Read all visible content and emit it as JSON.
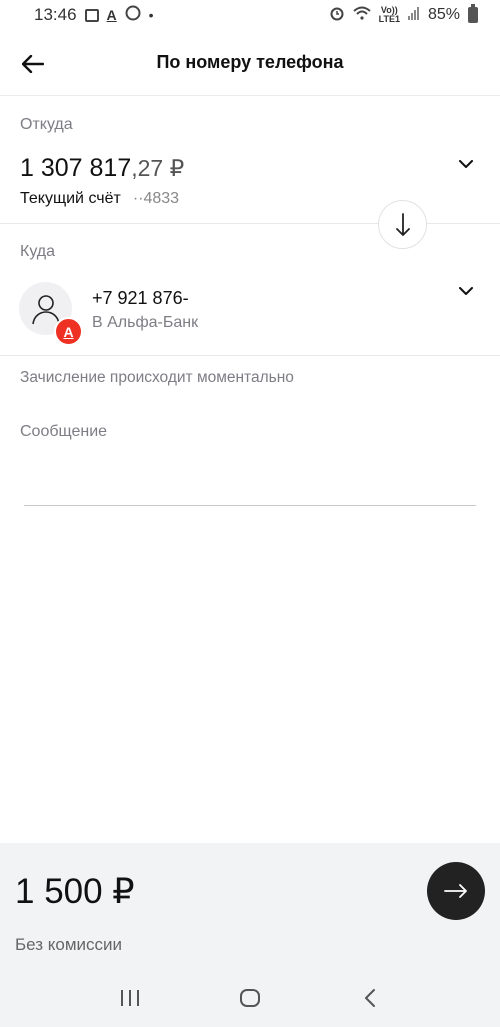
{
  "status_bar": {
    "time": "13:46",
    "a_glyph": "A",
    "dot": "•",
    "volte_top": "Vo))",
    "volte_bottom": "LTE1",
    "battery": "85%"
  },
  "header": {
    "title": "По номеру телефона"
  },
  "from": {
    "label": "Откуда",
    "balance_main": "1 307 817",
    "balance_cents": ",27 ₽",
    "account_name": "Текущий счёт",
    "account_number": "··4833"
  },
  "to": {
    "label": "Куда",
    "phone": "+7 921 876-",
    "bank": "В Альфа-Банк",
    "bank_badge": "А"
  },
  "instant_note": "Зачисление происходит моментально",
  "message": {
    "label": "Сообщение"
  },
  "summary": {
    "amount": "1 500 ₽",
    "commission": "Без комиссии"
  },
  "colors": {
    "accent": "#ef3124",
    "button_dark": "#222222",
    "panel": "#f2f3f5"
  }
}
